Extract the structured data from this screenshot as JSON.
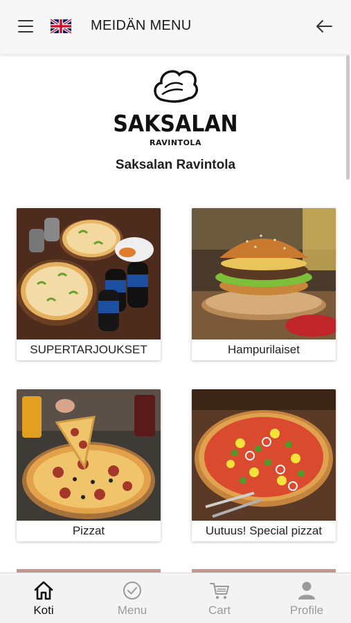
{
  "header": {
    "title": "MEIDÄN MENU",
    "menu_icon": "hamburger-icon",
    "language_flag": "uk-flag-icon",
    "back_icon": "arrow-left-icon"
  },
  "brand": {
    "logo_name": "SAKSALAN",
    "logo_sub": "RAVINTOLA",
    "restaurant_name": "Saksalan Ravintola"
  },
  "categories": [
    {
      "label": "SUPERTARJOUKSET"
    },
    {
      "label": "Hampurilaiset"
    },
    {
      "label": "Pizzat"
    },
    {
      "label": "Uutuus! Special pizzat"
    }
  ],
  "nav": {
    "items": [
      {
        "label": "Koti",
        "icon": "home-icon",
        "active": true
      },
      {
        "label": "Menu",
        "icon": "check-circle-icon",
        "active": false
      },
      {
        "label": "Cart",
        "icon": "cart-icon",
        "active": false
      },
      {
        "label": "Profile",
        "icon": "person-icon",
        "active": false
      }
    ]
  },
  "colors": {
    "header_bg": "#f7f7f7",
    "nav_bg": "#f3f3f3",
    "active_text": "#111111",
    "inactive_text": "#9a9a9a"
  }
}
